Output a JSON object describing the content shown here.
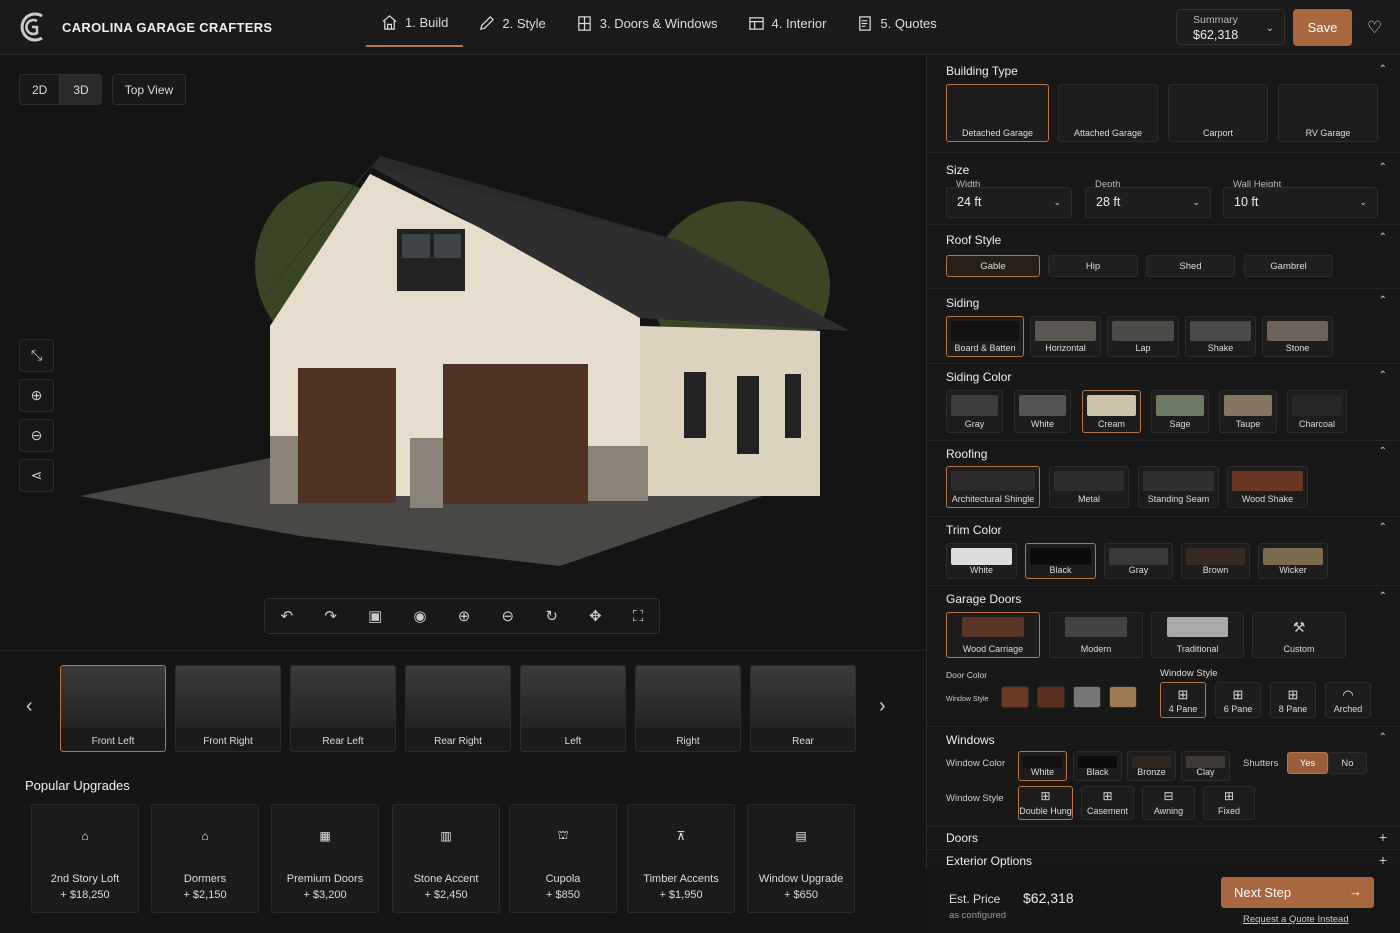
{
  "brand": "CAROLINA GARAGE CRAFTERS",
  "steps": [
    {
      "label": "1. Build",
      "icon": "house-icon"
    },
    {
      "label": "2. Style",
      "icon": "pencil-icon"
    },
    {
      "label": "3. Doors & Windows",
      "icon": "window-icon"
    },
    {
      "label": "4. Interior",
      "icon": "interior-icon"
    },
    {
      "label": "5. Quotes",
      "icon": "document-icon"
    }
  ],
  "summary": {
    "label": "Summary",
    "value": "$62,318"
  },
  "save": "Save",
  "view": {
    "b2d": "2D",
    "b3d": "3D",
    "top": "Top View"
  },
  "thumbs": [
    "Front Left",
    "Front Right",
    "Rear Left",
    "Rear Right",
    "Left",
    "Right",
    "Rear"
  ],
  "popular": {
    "title": "Popular Upgrades",
    "items": [
      {
        "name": "2nd Story Loft",
        "price": "+ $18,250"
      },
      {
        "name": "Dormers",
        "price": "+ $2,150"
      },
      {
        "name": "Premium Doors",
        "price": "+ $3,200"
      },
      {
        "name": "Stone Accent",
        "price": "+ $2,450"
      },
      {
        "name": "Cupola",
        "price": "+ $850"
      },
      {
        "name": "Timber Accents",
        "price": "+ $1,950"
      },
      {
        "name": "Window Upgrade",
        "price": "+ $650"
      }
    ]
  },
  "panel": {
    "building_type": {
      "title": "Building Type",
      "options": [
        "Detached Garage",
        "Attached Garage",
        "Carport",
        "RV Garage"
      ]
    },
    "size": {
      "title": "Size",
      "width_label": "Width",
      "width": "24 ft",
      "depth_label": "Depth",
      "depth": "28 ft",
      "height_label": "Wall Height",
      "height": "10 ft"
    },
    "roof": {
      "title": "Roof Style",
      "options": [
        "Gable",
        "Hip",
        "Shed",
        "Gambrel"
      ]
    },
    "siding": {
      "title": "Siding",
      "options": [
        "Board & Batten",
        "Horizontal",
        "Lap",
        "Shake",
        "Stone"
      ]
    },
    "siding_color": {
      "title": "Siding Color",
      "options": [
        "Gray",
        "White",
        "Cream",
        "Sage",
        "Taupe",
        "Charcoal"
      ]
    },
    "roofing": {
      "title": "Roofing",
      "options": [
        "Architectural Shingle",
        "Metal",
        "Standing Seam",
        "Wood Shake"
      ]
    },
    "trim": {
      "title": "Trim Color",
      "options": [
        "White",
        "Black",
        "Gray",
        "Brown",
        "Wicker"
      ]
    },
    "garage_doors": {
      "title": "Garage Doors",
      "options": [
        "Wood Carriage",
        "Modern",
        "Traditional",
        "Custom"
      ],
      "door_color": "Door Color",
      "window_style_small": "Window Style",
      "window_style": "Window Style",
      "panes": [
        "4 Pane",
        "6 Pane",
        "8 Pane",
        "Arched"
      ]
    },
    "windows": {
      "title": "Windows",
      "color_label": "Window Color",
      "colors": [
        "White",
        "Black",
        "Bronze",
        "Clay"
      ],
      "shutters": "Shutters",
      "yes": "Yes",
      "no": "No",
      "style_label": "Window Style",
      "styles": [
        "Double Hung",
        "Casement",
        "Awning",
        "Fixed"
      ]
    },
    "doors": "Doors",
    "exterior": "Exterior Options"
  },
  "price": {
    "label": "Est. Price",
    "value": "$62,318",
    "sub": "as configured",
    "next": "Next Step",
    "quote": "Request a Quote Instead"
  }
}
